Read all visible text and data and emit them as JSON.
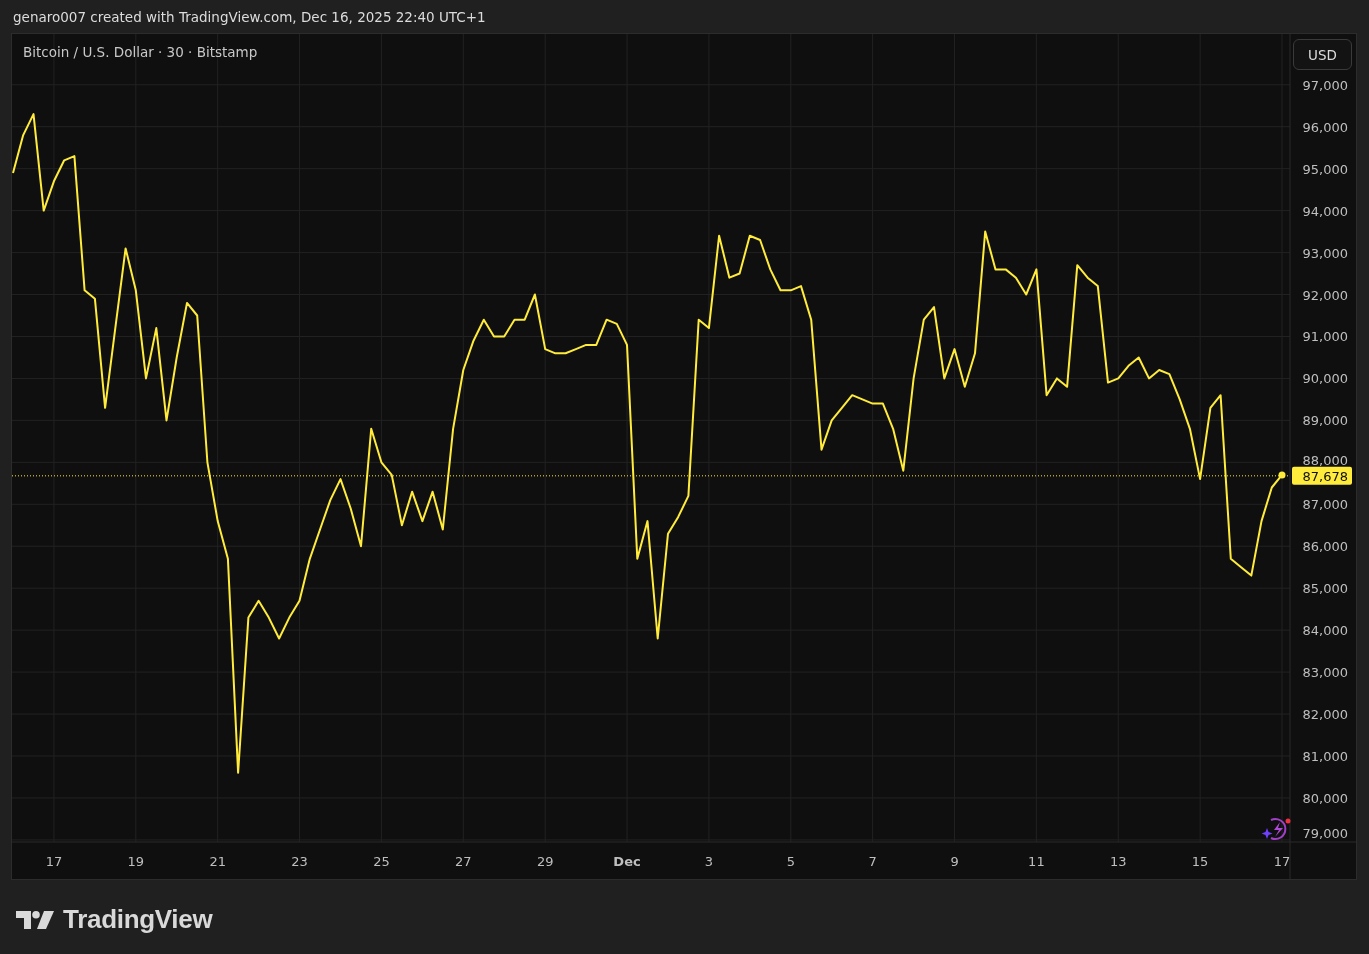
{
  "header": {
    "credit": "genaro007 created with TradingView.com, Dec 16, 2025 22:40 UTC+1"
  },
  "chart": {
    "currency_button": "USD",
    "chart_data": {
      "type": "line",
      "title": "Bitcoin / U.S. Dollar · 30 · Bitstamp",
      "categories": [
        null,
        null,
        null,
        null,
        "17",
        null,
        null,
        null,
        null,
        null,
        null,
        null,
        "19",
        null,
        null,
        null,
        null,
        null,
        null,
        null,
        "21",
        null,
        null,
        null,
        null,
        null,
        null,
        null,
        "23",
        null,
        null,
        null,
        null,
        null,
        null,
        null,
        "25",
        null,
        null,
        null,
        null,
        null,
        null,
        null,
        "27",
        null,
        null,
        null,
        null,
        null,
        null,
        null,
        "29",
        null,
        null,
        null,
        null,
        null,
        null,
        null,
        "Dec",
        null,
        null,
        null,
        null,
        null,
        null,
        null,
        "3",
        null,
        null,
        null,
        null,
        null,
        null,
        null,
        "5",
        null,
        null,
        null,
        null,
        null,
        null,
        null,
        "7",
        null,
        null,
        null,
        null,
        null,
        null,
        null,
        "9",
        null,
        null,
        null,
        null,
        null,
        null,
        null,
        "11",
        null,
        null,
        null,
        null,
        null,
        null,
        null,
        "13",
        null,
        null,
        null,
        null,
        null,
        null,
        null,
        "15",
        null,
        null,
        null,
        null,
        null,
        null,
        null,
        "17"
      ],
      "series": [
        {
          "color": "#ffeb3b",
          "values": [
            94900,
            95800,
            96300,
            94000,
            94700,
            95200,
            95300,
            92100,
            91900,
            89300,
            91200,
            93100,
            92100,
            90000,
            91200,
            89000,
            90500,
            91800,
            91500,
            88000,
            86600,
            85700,
            80600,
            84300,
            84700,
            84300,
            83800,
            84300,
            84700,
            85700,
            86400,
            87100,
            87600,
            86900,
            86000,
            88800,
            88000,
            87700,
            86500,
            87300,
            86600,
            87300,
            86400,
            88800,
            90200,
            90900,
            91400,
            91000,
            91000,
            91400,
            91400,
            92000,
            90700,
            90600,
            90600,
            90700,
            90800,
            90800,
            91400,
            91300,
            90800,
            85700,
            86600,
            83800,
            86300,
            86700,
            87200,
            91400,
            91200,
            93400,
            92400,
            92500,
            93400,
            93300,
            92600,
            92100,
            92100,
            92200,
            91400,
            88300,
            89000,
            89300,
            89600,
            89500,
            89400,
            89400,
            88800,
            87800,
            90000,
            91400,
            91700,
            90000,
            90700,
            89800,
            90600,
            93500,
            92600,
            92600,
            92400,
            92000,
            92600,
            89600,
            90000,
            89800,
            92700,
            92400,
            92200,
            89900,
            90000,
            90300,
            90500,
            90000,
            90200,
            90100,
            89500,
            88800,
            87600,
            89300,
            89600,
            85700,
            85500,
            85300,
            86600,
            87400,
            87700
          ]
        }
      ],
      "ylim": [
        78950,
        98210
      ],
      "yticks": [
        {
          "value": 97000,
          "label": "97,000"
        },
        {
          "value": 96000,
          "label": "96,000"
        },
        {
          "value": 95000,
          "label": "95,000"
        },
        {
          "value": 94000,
          "label": "94,000"
        },
        {
          "value": 93000,
          "label": "93,000"
        },
        {
          "value": 92000,
          "label": "92,000"
        },
        {
          "value": 91000,
          "label": "91,000"
        },
        {
          "value": 90000,
          "label": "90,000"
        },
        {
          "value": 89000,
          "label": "89,000"
        },
        {
          "value": 88000,
          "label": "88,000"
        },
        {
          "value": 87000,
          "label": "87,000"
        },
        {
          "value": 86000,
          "label": "86,000"
        },
        {
          "value": 85000,
          "label": "85,000"
        },
        {
          "value": 84000,
          "label": "84,000"
        },
        {
          "value": 83000,
          "label": "83,000"
        },
        {
          "value": 82000,
          "label": "82,000"
        },
        {
          "value": 81000,
          "label": "81,000"
        },
        {
          "value": 80000,
          "label": "80,000"
        },
        {
          "value": 79000,
          "label": "79,000"
        }
      ],
      "grid": true,
      "ref_lines": [
        {
          "axis": "y",
          "value": 87678,
          "label": "87,678"
        }
      ]
    }
  },
  "footer": {
    "logo_text": "TradingView"
  }
}
